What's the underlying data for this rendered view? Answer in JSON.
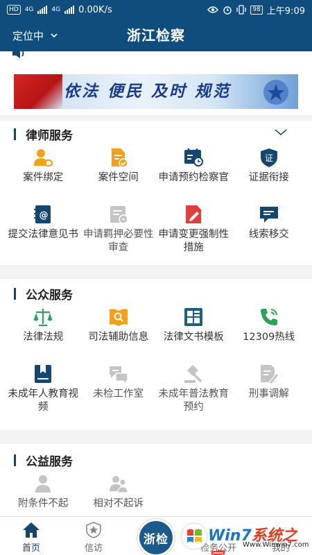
{
  "status_bar": {
    "hd": "HD",
    "network_1": "4G",
    "network_2": "4G",
    "speed": "0.00K/s",
    "battery": "98",
    "time": "上午9:09"
  },
  "header": {
    "location": "定位中",
    "title": "浙江检察"
  },
  "banner": {
    "text": "依法 便民 及时 规范"
  },
  "lawyer_services": {
    "title": "律师服务",
    "items": [
      {
        "label": "案件绑定",
        "icon": "person-link-icon"
      },
      {
        "label": "案件空间",
        "icon": "document-check-icon"
      },
      {
        "label": "申请预约检察官",
        "icon": "calendar-clock-icon"
      },
      {
        "label": "证据衔接",
        "icon": "certificate-shield-icon"
      },
      {
        "label": "提交法律意见书",
        "icon": "notebook-at-icon"
      },
      {
        "label": "申请羁押必要性审查",
        "icon": "form-review-icon"
      },
      {
        "label": "申请变更强制性措施",
        "icon": "document-edit-icon"
      },
      {
        "label": "线索移交",
        "icon": "chat-transfer-icon"
      }
    ]
  },
  "public_services": {
    "title": "公众服务",
    "items": [
      {
        "label": "法律法规",
        "icon": "scales-icon"
      },
      {
        "label": "司法辅助信息",
        "icon": "book-search-icon"
      },
      {
        "label": "法律文书模板",
        "icon": "template-grid-icon"
      },
      {
        "label": "12309热线",
        "icon": "phone-icon"
      },
      {
        "label": "未成年人教育视频",
        "icon": "bookmark-book-icon"
      },
      {
        "label": "未检工作室",
        "icon": "chat-bubbles-icon"
      },
      {
        "label": "未成年普法教育预约",
        "icon": "gavel-icon"
      },
      {
        "label": "刑事调解",
        "icon": "document-pen-icon"
      }
    ]
  },
  "welfare_services": {
    "title": "公益服务",
    "items": [
      {
        "label": "附条件不起",
        "icon": "person-icon"
      },
      {
        "label": "相对不起诉",
        "icon": "people-icon"
      }
    ]
  },
  "tabbar": {
    "home": "首页",
    "petition": "信访",
    "center": "浙检",
    "affairs": "检务公开",
    "mine": "我的"
  },
  "watermark": {
    "brand_1": "Win7",
    "brand_2": "系统之家",
    "url": "Www.Winwin7.com"
  },
  "colors": {
    "primary": "#0e4d7e",
    "accent_orange": "#f3a01d",
    "accent_green": "#2aa35a",
    "accent_red": "#e23d3d",
    "icon_gray": "#b8b8b8"
  }
}
